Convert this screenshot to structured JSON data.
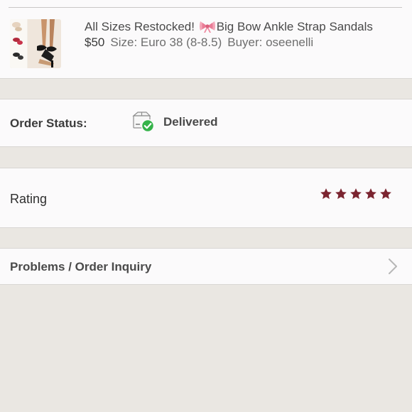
{
  "item": {
    "title_prefix": "All Sizes Restocked!",
    "title_emoji": "bow-emoji",
    "title_suffix": "Big Bow Ankle Strap Sandals",
    "price": "$50",
    "size": "Size: Euro 38 (8-8.5)",
    "buyer": "Buyer: oseenelli",
    "thumbnail_icon": "sandals-product-photo"
  },
  "order_status": {
    "label": "Order Status:",
    "value": "Delivered",
    "icon": "delivered-box-check-icon"
  },
  "rating": {
    "label": "Rating",
    "stars": 5,
    "max_stars": 5,
    "star_color": "#7b2430"
  },
  "inquiry": {
    "label": "Problems / Order Inquiry",
    "icon": "chevron-right-icon"
  },
  "colors": {
    "background": "#eae7e2",
    "card": "#fbfafb",
    "check_green": "#35b34a"
  }
}
